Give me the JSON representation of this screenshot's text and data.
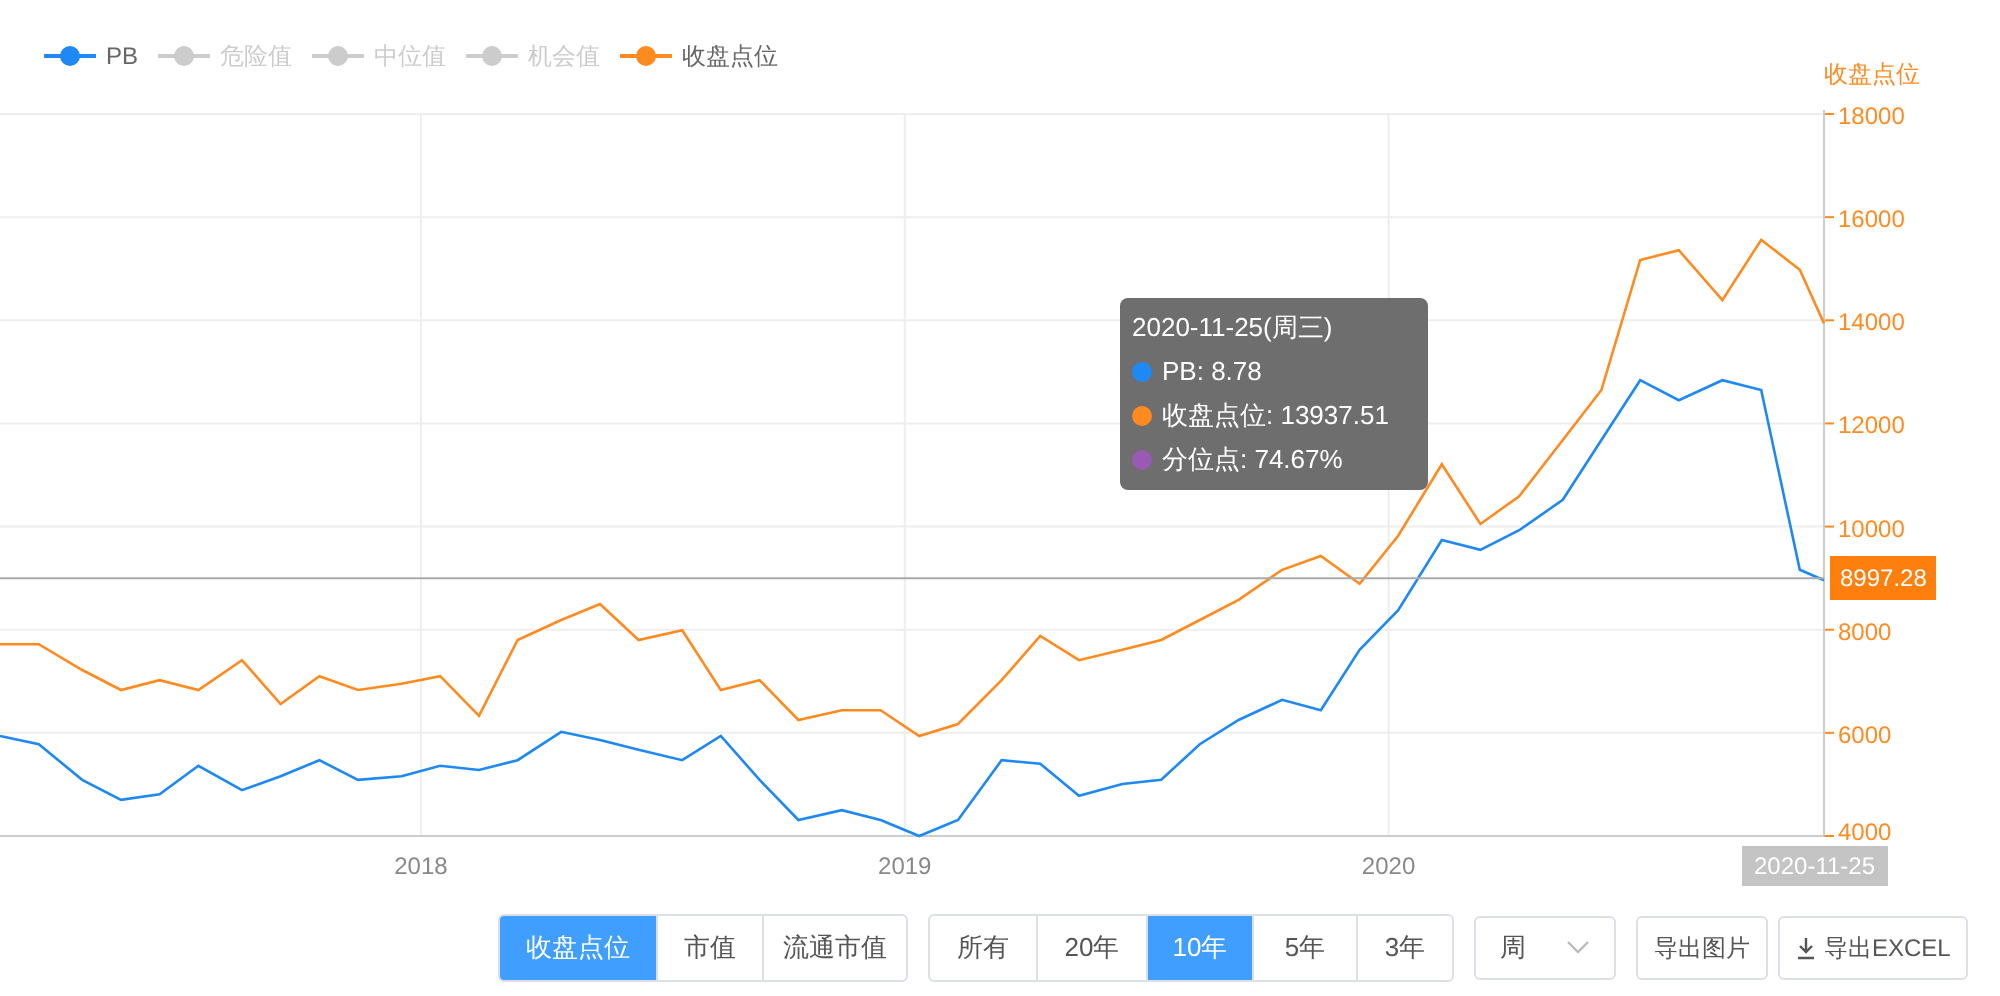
{
  "legend": [
    {
      "label": "PB",
      "color": "#1e88f5",
      "on": true
    },
    {
      "label": "危险值",
      "on": false
    },
    {
      "label": "中位值",
      "on": false
    },
    {
      "label": "机会值",
      "on": false
    },
    {
      "label": "收盘点位",
      "color": "#ff8a1f",
      "on": true
    }
  ],
  "chart_data": {
    "type": "line",
    "ylabel": "收盘点位",
    "grid": true,
    "ref_lines": [
      {
        "axis": "y",
        "value": 8997.28,
        "label": "8997.28"
      }
    ],
    "xlim": [
      2017.13,
      2020.9
    ],
    "ylim": [
      4000,
      18000
    ],
    "xticks": [
      {
        "value": 2018,
        "label": "2018"
      },
      {
        "value": 2019,
        "label": "2019"
      },
      {
        "value": 2020,
        "label": "2020"
      }
    ],
    "yticks": [
      4000,
      6000,
      8000,
      10000,
      12000,
      14000,
      16000,
      18000
    ],
    "x": [
      2017.13,
      2017.21,
      2017.3,
      2017.38,
      2017.46,
      2017.54,
      2017.63,
      2017.71,
      2017.79,
      2017.87,
      2017.96,
      2018.04,
      2018.12,
      2018.2,
      2018.29,
      2018.37,
      2018.45,
      2018.54,
      2018.62,
      2018.7,
      2018.78,
      2018.87,
      2018.95,
      2019.03,
      2019.11,
      2019.2,
      2019.28,
      2019.36,
      2019.45,
      2019.53,
      2019.61,
      2019.69,
      2019.78,
      2019.86,
      2019.94,
      2020.02,
      2020.11,
      2020.19,
      2020.27,
      2020.36,
      2020.44,
      2020.52,
      2020.6,
      2020.69,
      2020.77,
      2020.85,
      2020.9
    ],
    "series": [
      {
        "color": "#1e88f5",
        "values": [
          5940,
          5780,
          5090,
          4700,
          4810,
          5360,
          4890,
          5160,
          5470,
          5090,
          5160,
          5360,
          5280,
          5470,
          6020,
          5860,
          5670,
          5470,
          5940,
          5090,
          4310,
          4500,
          4310,
          4000,
          4310,
          5470,
          5400,
          4780,
          5010,
          5090,
          5780,
          6250,
          6640,
          6440,
          7610,
          8380,
          9740,
          9550,
          9930,
          10520,
          11680,
          12840,
          12450,
          12840,
          12650,
          9160,
          8960
        ]
      },
      {
        "color": "#ff8a1f",
        "values": [
          7720,
          7720,
          7220,
          6830,
          7020,
          6830,
          7410,
          6560,
          7100,
          6830,
          6950,
          7100,
          6330,
          7800,
          8190,
          8500,
          7800,
          7990,
          6830,
          7020,
          6250,
          6440,
          6440,
          5940,
          6170,
          7020,
          7880,
          7410,
          7610,
          7800,
          8190,
          8580,
          9160,
          9430,
          8890,
          9820,
          11210,
          10050,
          10590,
          11680,
          12650,
          15170,
          15360,
          14390,
          15560,
          14980,
          13940
        ]
      }
    ]
  },
  "axis_pointer_label": "2020-11-25",
  "tooltip": {
    "title": "2020-11-25(周三)",
    "items": [
      {
        "text": "PB: 8.78",
        "color": "#1e88f5"
      },
      {
        "text": "收盘点位: 13937.51",
        "color": "#ff8a1f"
      },
      {
        "text": "分位点: 74.67%",
        "color": "#9b59b6"
      }
    ]
  },
  "metric_buttons": [
    {
      "label": "收盘点位",
      "selected": true
    },
    {
      "label": "市值",
      "selected": false
    },
    {
      "label": "流通市值",
      "selected": false
    }
  ],
  "range_buttons": [
    {
      "label": "所有",
      "selected": false
    },
    {
      "label": "20年",
      "selected": false
    },
    {
      "label": "10年",
      "selected": true
    },
    {
      "label": "5年",
      "selected": false
    },
    {
      "label": "3年",
      "selected": false
    }
  ],
  "period_select": {
    "value": "周"
  },
  "export_buttons": [
    {
      "label": "导出图片",
      "kind": "plain"
    },
    {
      "label": "导出EXCEL",
      "kind": "download"
    }
  ]
}
